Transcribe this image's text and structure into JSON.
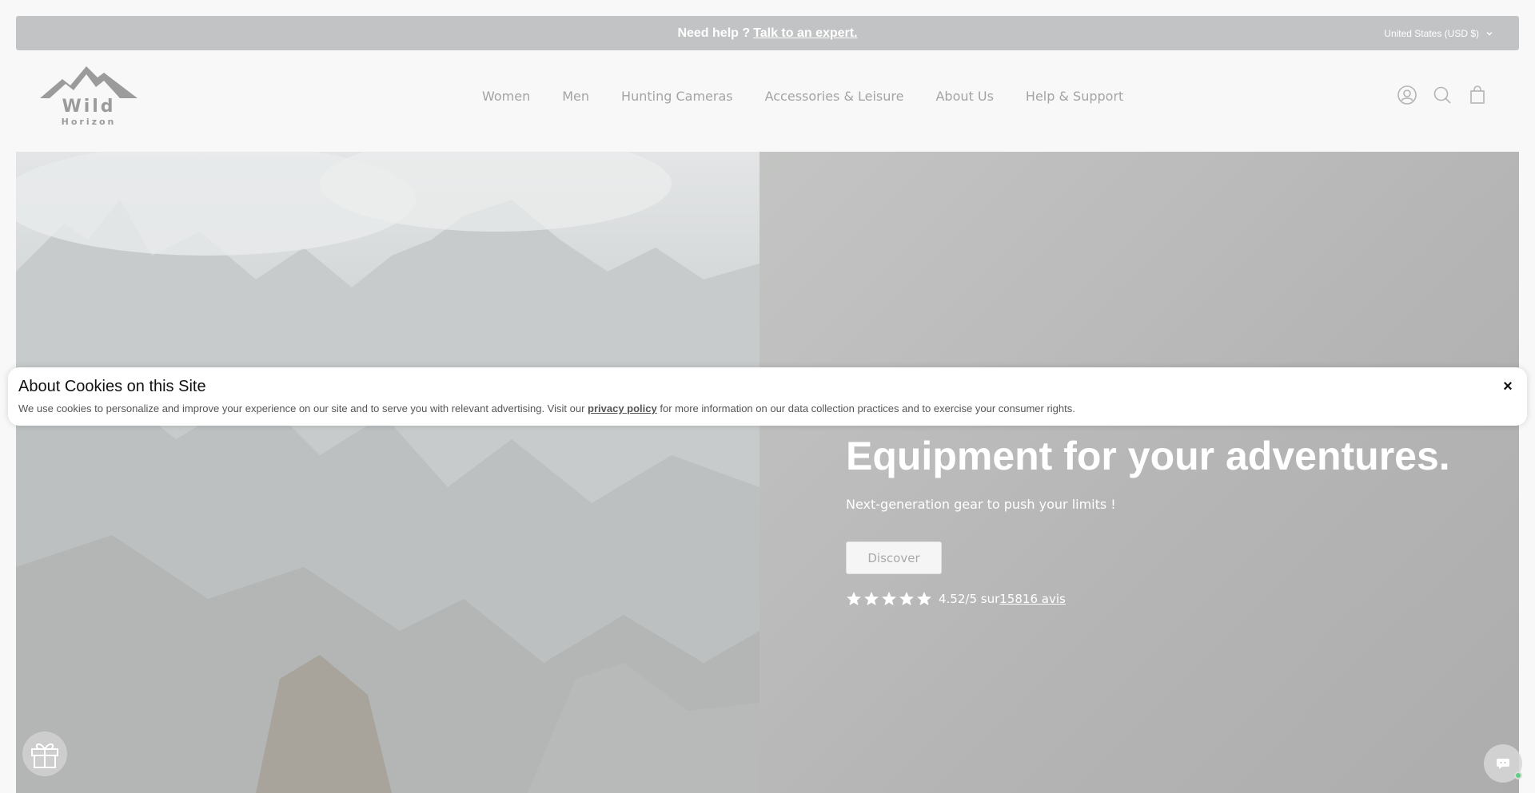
{
  "announcement": {
    "text": "Need help ? ",
    "link": "Talk to an expert.",
    "currency": "United States (USD $)"
  },
  "logo": {
    "line1": "Wild",
    "line2": "Horizon"
  },
  "nav": {
    "items": [
      "Women",
      "Men",
      "Hunting Cameras",
      "Accessories & Leisure",
      "About Us",
      "Help & Support"
    ]
  },
  "header_icons": [
    "account-icon",
    "search-icon",
    "bag-icon"
  ],
  "hero": {
    "title": "Equipment for your adventures.",
    "subtitle": "Next-generation gear to push your limits !",
    "button": "Discover",
    "rating_text": "4.52/5 sur ",
    "reviews": "15816 avis",
    "stars": 5
  },
  "cookie": {
    "title": "About Cookies on this Site",
    "text_before": "We use cookies to personalize and improve your experience on our site and to serve you with relevant advertising. Visit our ",
    "link": "privacy policy",
    "text_after": " for more information on our data collection practices and to exercise your consumer rights.",
    "close": "×"
  },
  "colors": {
    "announcement_bg": "#c2c3c4",
    "hero_right_bg": "#b4b4b4",
    "online_dot": "#5fcf80"
  }
}
